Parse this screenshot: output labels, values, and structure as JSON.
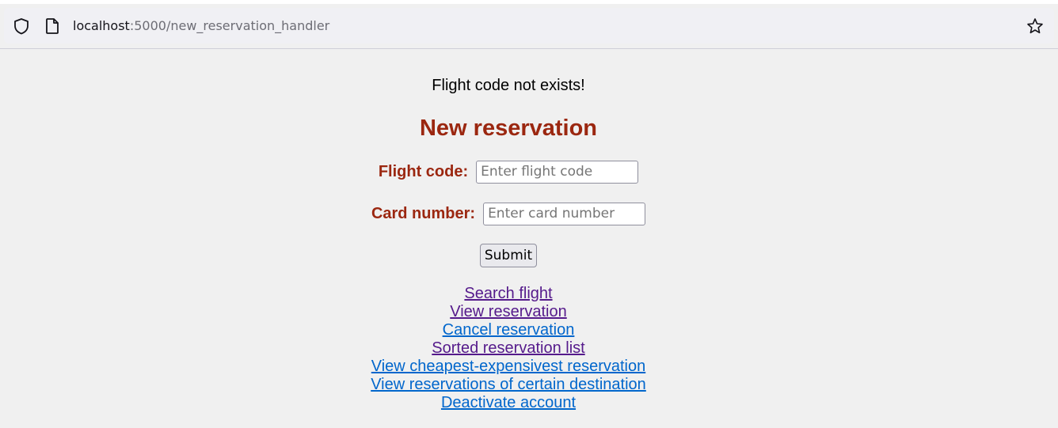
{
  "browser": {
    "url_host": "localhost",
    "url_rest": ":5000/new_reservation_handler",
    "icons": [
      "shield-icon",
      "page-icon",
      "bookmark-star-icon"
    ]
  },
  "page": {
    "message": "Flight code not exists!",
    "heading": "New reservation",
    "form": {
      "flight_code_label": "Flight code:",
      "flight_code_value": "",
      "flight_code_placeholder": "Enter flight code",
      "card_number_label": "Card number:",
      "card_number_value": "",
      "card_number_placeholder": "Enter card number",
      "submit_label": "Submit"
    },
    "links": [
      {
        "label": "Search flight",
        "visited": true
      },
      {
        "label": "View reservation",
        "visited": true
      },
      {
        "label": "Cancel reservation",
        "visited": false
      },
      {
        "label": "Sorted reservation list",
        "visited": true
      },
      {
        "label": "View cheapest-expensivest reservation",
        "visited": false
      },
      {
        "label": "View reservations of certain destination",
        "visited": false
      },
      {
        "label": "Deactivate account",
        "visited": false
      }
    ]
  },
  "colors": {
    "heading": "#9b2710",
    "link": "#0066cc",
    "visited_link": "#551a8b",
    "background": "#f0f0f0"
  }
}
